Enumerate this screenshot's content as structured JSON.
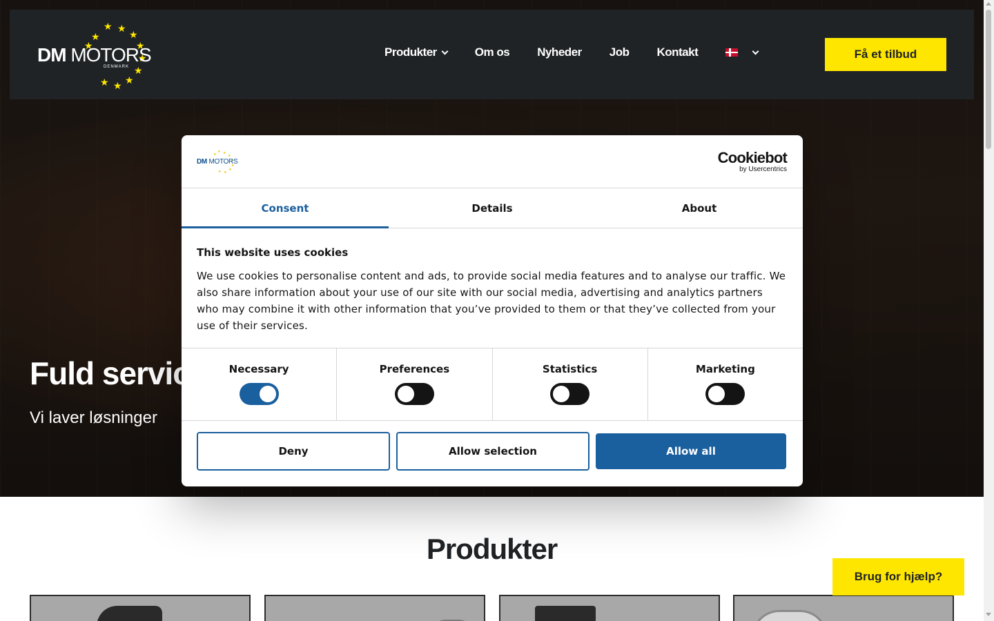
{
  "header": {
    "logo_text_bold": "DM",
    "logo_text_light": "MOTORS",
    "logo_sub": "DENMARK",
    "nav": [
      {
        "label": "Produkter",
        "has_dropdown": true
      },
      {
        "label": "Om os"
      },
      {
        "label": "Nyheder"
      },
      {
        "label": "Job"
      },
      {
        "label": "Kontakt"
      }
    ],
    "language_icon": "danish-flag-icon",
    "cta_label": "Få et tilbud"
  },
  "hero": {
    "title": "Fuld servic",
    "subtitle": "Vi laver løsninger"
  },
  "products": {
    "title": "Produkter"
  },
  "help_button": "Brug for hjælp?",
  "cookie_dialog": {
    "logo_bold": "DM",
    "logo_light": "MOTORS",
    "provider_main": "Cookiebot",
    "provider_sub": "by Usercentrics",
    "tabs": [
      {
        "label": "Consent",
        "active": true
      },
      {
        "label": "Details",
        "active": false
      },
      {
        "label": "About",
        "active": false
      }
    ],
    "title": "This website uses cookies",
    "text": "We use cookies to personalise content and ads, to provide social media features and to analyse our traffic. We also share information about your use of our site with our social media, advertising and analytics partners who may combine it with other information that you’ve provided to them or that they’ve collected from your use of their services.",
    "toggles": [
      {
        "label": "Necessary",
        "on": true
      },
      {
        "label": "Preferences",
        "on": false
      },
      {
        "label": "Statistics",
        "on": false
      },
      {
        "label": "Marketing",
        "on": false
      }
    ],
    "buttons": {
      "deny": "Deny",
      "allow_selection": "Allow selection",
      "allow_all": "Allow all"
    }
  },
  "colors": {
    "brand_yellow": "#ffe600",
    "header_bg": "#1f2326",
    "cookie_accent": "#1a5f9e"
  }
}
